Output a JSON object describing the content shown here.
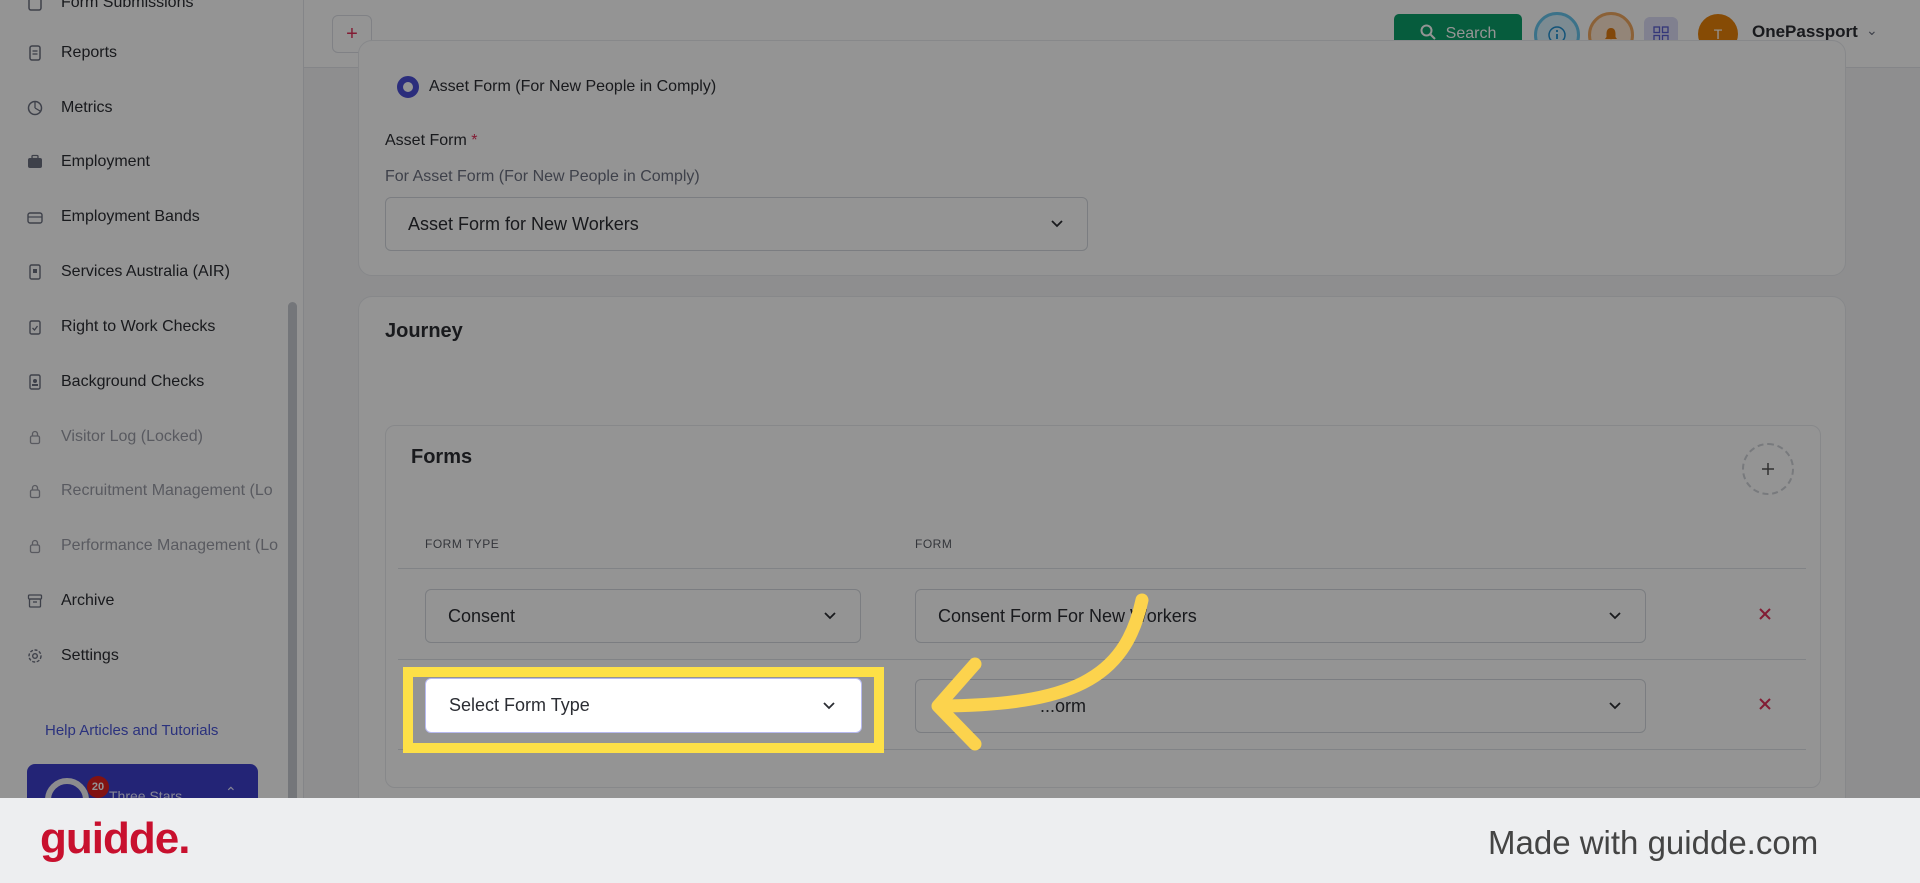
{
  "sidebar": {
    "items": [
      {
        "label": "Form Submissions",
        "icon": "form-icon",
        "locked": false
      },
      {
        "label": "Reports",
        "icon": "report-icon",
        "locked": false
      },
      {
        "label": "Metrics",
        "icon": "pie-chart-icon",
        "locked": false
      },
      {
        "label": "Employment",
        "icon": "briefcase-icon",
        "locked": false
      },
      {
        "label": "Employment Bands",
        "icon": "briefcase-outline-icon",
        "locked": false
      },
      {
        "label": "Services Australia (AIR)",
        "icon": "document-icon",
        "locked": false
      },
      {
        "label": "Right to Work Checks",
        "icon": "clipboard-check-icon",
        "locked": false
      },
      {
        "label": "Background Checks",
        "icon": "id-card-icon",
        "locked": false
      },
      {
        "label": "Visitor Log (Locked)",
        "icon": "lock-icon",
        "locked": true
      },
      {
        "label": "Recruitment Management (Lo",
        "icon": "lock-icon",
        "locked": true
      },
      {
        "label": "Performance Management (Lo",
        "icon": "lock-icon",
        "locked": true
      },
      {
        "label": "Archive",
        "icon": "archive-icon",
        "locked": false
      },
      {
        "label": "Settings",
        "icon": "gear-icon",
        "locked": false
      }
    ],
    "help_link": "Help Articles and Tutorials",
    "promo": {
      "badge": "20",
      "text": "Three Stars"
    }
  },
  "header": {
    "plus": "+",
    "search_label": "Search",
    "avatar_initial": "T",
    "org_name": "OnePassport"
  },
  "asset_section": {
    "radio_label": "Asset Form (For New People in Comply)",
    "field_label": "Asset Form",
    "required_mark": "*",
    "field_hint": "For Asset Form (For New People in Comply)",
    "selected_value": "Asset Form for New Workers"
  },
  "journey": {
    "title": "Journey",
    "forms_title": "Forms",
    "columns": [
      "FORM TYPE",
      "FORM"
    ],
    "rows": [
      {
        "form_type": "Consent",
        "form": "Consent Form For New Workers"
      },
      {
        "form_type": "Select Form Type",
        "form": "...orm"
      }
    ]
  },
  "footer": {
    "brand": "guidde.",
    "made_with": "Made with guidde.com"
  },
  "colors": {
    "accent": "#4a4fd6",
    "search_green": "#0b9f6a",
    "highlight_yellow": "#fde047",
    "danger": "#e0315a",
    "brand_red": "#c8102e"
  }
}
